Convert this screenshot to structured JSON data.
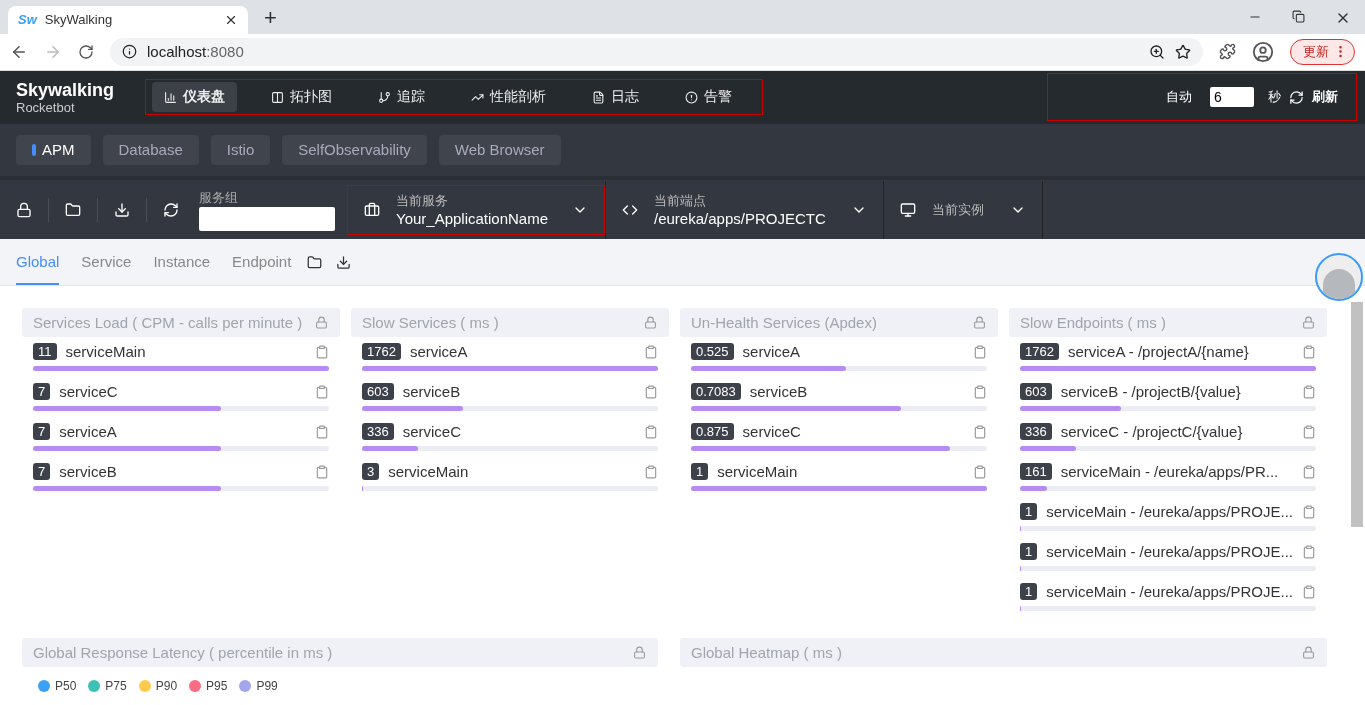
{
  "browser": {
    "tab_title": "SkyWalking",
    "favicon_text": "Sw",
    "new_tab": "+",
    "url_host": "localhost",
    "url_port": ":8080",
    "update_button": "更新"
  },
  "header": {
    "logo": "Skywalking",
    "logo_sub": "Rocketbot",
    "nav": [
      {
        "label": "仪表盘",
        "kind": "dashboard",
        "selected": true
      },
      {
        "label": "拓扑图",
        "kind": "topology",
        "selected": false
      },
      {
        "label": "追踪",
        "kind": "trace",
        "selected": false
      },
      {
        "label": "性能剖析",
        "kind": "profile",
        "selected": false
      },
      {
        "label": "日志",
        "kind": "log",
        "selected": false
      },
      {
        "label": "告警",
        "kind": "alarm",
        "selected": false
      }
    ],
    "auto_label": "自动",
    "interval": "6",
    "seconds_label": "秒",
    "refresh_label": "刷新"
  },
  "layers": [
    {
      "label": "APM",
      "selected": true
    },
    {
      "label": "Database",
      "selected": false
    },
    {
      "label": "Istio",
      "selected": false
    },
    {
      "label": "SelfObservability",
      "selected": false
    },
    {
      "label": "Web Browser",
      "selected": false
    }
  ],
  "toolbar": {
    "group_label": "服务组",
    "service": {
      "label": "当前服务",
      "value": "Your_ApplicationName"
    },
    "endpoint": {
      "label": "当前端点",
      "value": "/eureka/apps/PROJECTC"
    },
    "instance": {
      "label": "当前实例"
    }
  },
  "tabs": [
    {
      "label": "Global",
      "selected": true
    },
    {
      "label": "Service",
      "selected": false
    },
    {
      "label": "Instance",
      "selected": false
    },
    {
      "label": "Endpoint",
      "selected": false
    }
  ],
  "panels": [
    {
      "title": "Services Load ( CPM - calls per minute )",
      "items": [
        {
          "value": "11",
          "name": "serviceMain",
          "level": 1
        },
        {
          "value": "7",
          "name": "serviceC",
          "level": 0.636
        },
        {
          "value": "7",
          "name": "serviceA",
          "level": 0.636
        },
        {
          "value": "7",
          "name": "serviceB",
          "level": 0.636
        }
      ]
    },
    {
      "title": "Slow Services ( ms )",
      "items": [
        {
          "value": "1762",
          "name": "serviceA",
          "level": 1
        },
        {
          "value": "603",
          "name": "serviceB",
          "level": 0.342
        },
        {
          "value": "336",
          "name": "serviceC",
          "level": 0.19
        },
        {
          "value": "3",
          "name": "serviceMain",
          "level": 0.002
        }
      ]
    },
    {
      "title": "Un-Health Services (Apdex)",
      "items": [
        {
          "value": "0.525",
          "name": "serviceA",
          "level": 0.525
        },
        {
          "value": "0.7083",
          "name": "serviceB",
          "level": 0.7083
        },
        {
          "value": "0.875",
          "name": "serviceC",
          "level": 0.875
        },
        {
          "value": "1",
          "name": "serviceMain",
          "level": 1
        }
      ]
    },
    {
      "title": "Slow Endpoints ( ms )",
      "items": [
        {
          "value": "1762",
          "name": "serviceA - /projectA/{name}",
          "level": 1
        },
        {
          "value": "603",
          "name": "serviceB - /projectB/{value}",
          "level": 0.342
        },
        {
          "value": "336",
          "name": "serviceC - /projectC/{value}",
          "level": 0.19
        },
        {
          "value": "161",
          "name": "serviceMain - /eureka/apps/PR...",
          "level": 0.091
        },
        {
          "value": "1",
          "name": "serviceMain - /eureka/apps/PROJE...",
          "level": 0.002
        },
        {
          "value": "1",
          "name": "serviceMain - /eureka/apps/PROJE...",
          "level": 0.002
        },
        {
          "value": "1",
          "name": "serviceMain - /eureka/apps/PROJE...",
          "level": 0.002
        }
      ]
    }
  ],
  "bottom_panels": [
    {
      "title": "Global Response Latency ( percentile in ms )",
      "legend": [
        {
          "label": "P50",
          "color": "#3ba1f5"
        },
        {
          "label": "P75",
          "color": "#3cc2b4"
        },
        {
          "label": "P90",
          "color": "#ffcb4d"
        },
        {
          "label": "P95",
          "color": "#fa6c84"
        },
        {
          "label": "P99",
          "color": "#a3a6ec"
        }
      ]
    },
    {
      "title": "Global Heatmap ( ms )"
    }
  ]
}
